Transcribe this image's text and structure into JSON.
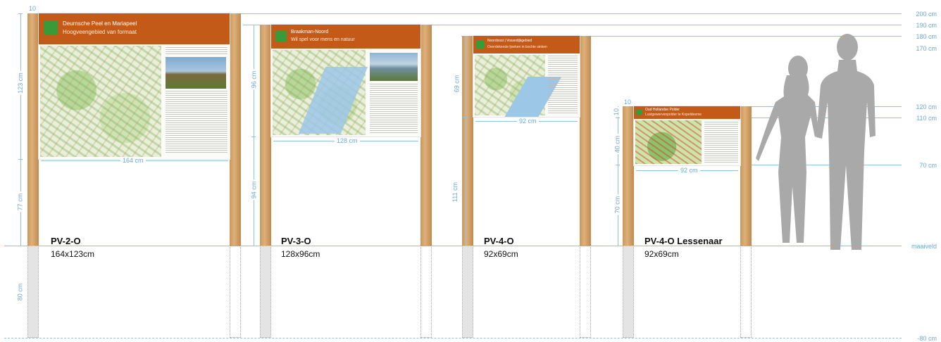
{
  "levels": {
    "l200": "200 cm",
    "l190": "190 cm",
    "l180": "180 cm",
    "l170": "170 cm",
    "l120": "120 cm",
    "l110": "110 cm",
    "l70": "70 cm",
    "ground": "maaiveld",
    "lminus80": "-80 cm"
  },
  "signs": [
    {
      "model": "PV-2-O",
      "size": "164x123cm",
      "panel_title": "Deurnsche Peel en Mariapeel",
      "panel_subtitle": "Hoogveengebied van formaat",
      "width_dim": "164 cm",
      "height_dim": "123 cm",
      "leg_dim": "77 cm",
      "top_dim": "10"
    },
    {
      "model": "PV-3-O",
      "size": "128x96cm",
      "panel_title": "Braakman-Noord",
      "panel_subtitle": "Wil spel voor mens en natuur",
      "width_dim": "128 cm",
      "height_dim": "96 cm",
      "leg_dim": "94 cm"
    },
    {
      "model": "PV-4-O",
      "size": "92x69cm",
      "panel_title": "Noordoost | Vossedijkgebied",
      "panel_subtitle": "Overdekende  ljoeken in bochte  sinken",
      "width_dim": "92 cm",
      "height_dim": "69 cm",
      "leg_dim": "111 cm"
    },
    {
      "model": "PV-4-O Lessenaar",
      "size": "92x69cm",
      "panel_title": "Oud Hollandse Polder",
      "panel_subtitle": "Lustgewervenpolder te Kopeldeeme",
      "width_dim": "92 cm",
      "height_dim": "40 cm",
      "leg_dim": "70 cm",
      "top_dim": "10",
      "side_dim": "10"
    }
  ],
  "underground_dim": "80 cm",
  "colors": {
    "accent_line": "#8cc3e6",
    "panel_header": "#c45a18",
    "post_wood": "#d3a46c",
    "people": "#a9a9a9"
  }
}
